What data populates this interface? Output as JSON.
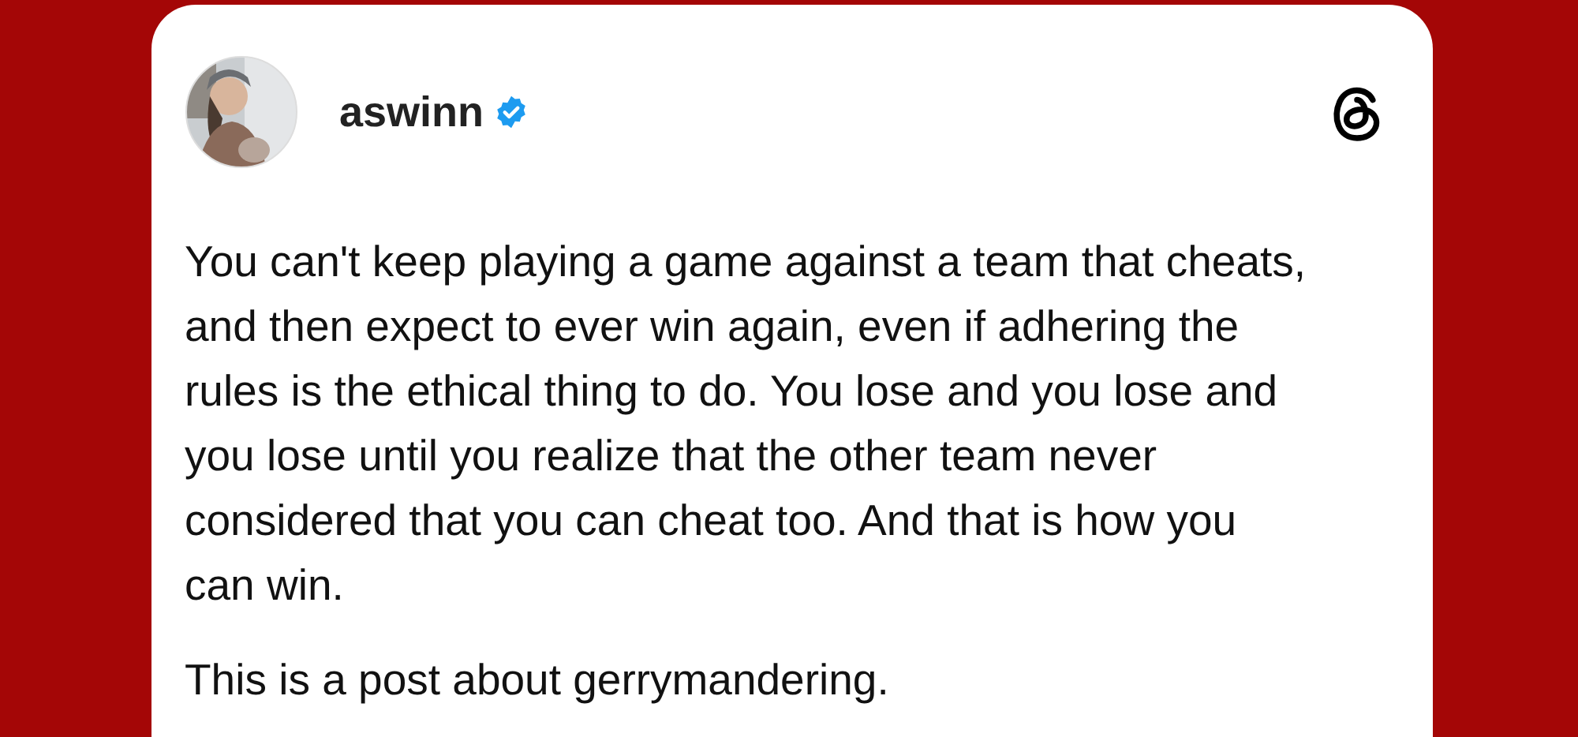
{
  "post": {
    "author": {
      "username": "aswinn",
      "verified": true
    },
    "paragraphs": [
      "You can't keep playing a game against a team that cheats,\nand then expect to ever win again, even if adhering the\nrules is the ethical thing to do. You lose and you lose and\nyou lose until you realize that the other team never\nconsidered that you can cheat too. And that is how you\ncan win.",
      "This is a post about gerrymandering."
    ]
  }
}
